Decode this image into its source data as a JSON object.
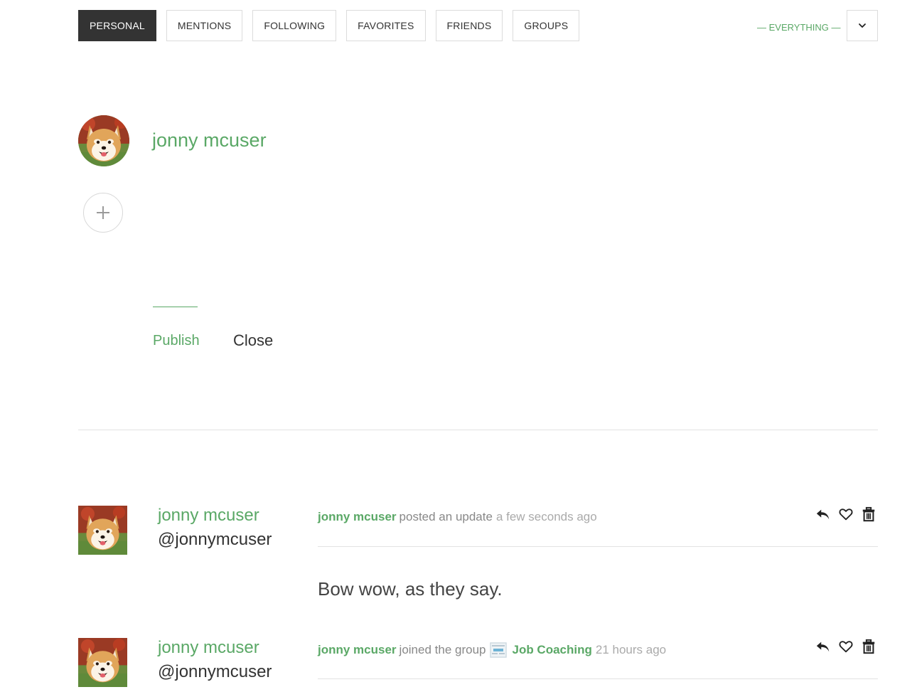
{
  "tabs": [
    {
      "label": "PERSONAL",
      "active": true
    },
    {
      "label": "MENTIONS",
      "active": false
    },
    {
      "label": "FOLLOWING",
      "active": false
    },
    {
      "label": "FAVORITES",
      "active": false
    },
    {
      "label": "FRIENDS",
      "active": false
    },
    {
      "label": "GROUPS",
      "active": false
    }
  ],
  "filter": {
    "label": "— EVERYTHING —",
    "dropdown_icon": "chevron-down-icon"
  },
  "composer": {
    "user_name": "jonny mcuser",
    "add_icon": "plus-icon",
    "publish_label": "Publish",
    "close_label": "Close"
  },
  "activities": [
    {
      "user_name": "jonny mcuser",
      "user_handle": "@jonnymcuser",
      "actor": "jonny mcuser",
      "action": "posted an update",
      "time": "a few seconds ago",
      "content": "Bow wow, as they say."
    },
    {
      "user_name": "jonny mcuser",
      "user_handle": "@jonnymcuser",
      "actor": "jonny mcuser",
      "action": "joined the group",
      "group": "Job Coaching",
      "time": "21 hours ago"
    }
  ],
  "action_icons": [
    "reply-icon",
    "heart-icon",
    "trash-icon"
  ],
  "colors": {
    "accent": "#5aa866",
    "active_tab": "#333333",
    "border": "#dcdcdc",
    "muted_text": "#888888"
  }
}
